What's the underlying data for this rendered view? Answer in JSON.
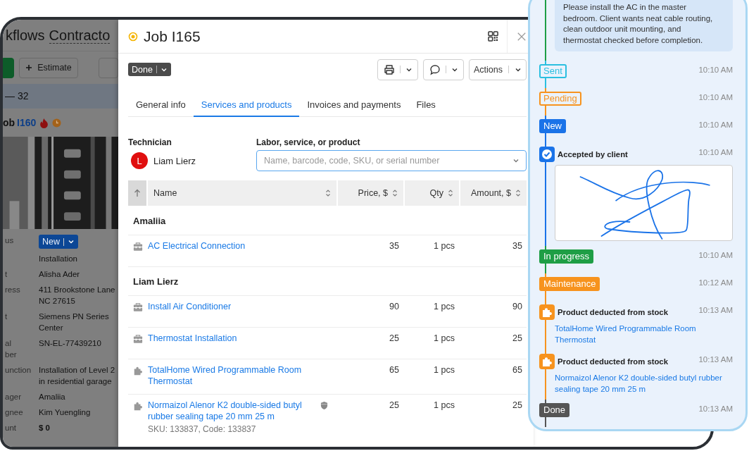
{
  "background_app": {
    "title": "kflows",
    "selector": "Contracto",
    "buttons": [
      {
        "kind": "primary"
      },
      {
        "kind": "secondary",
        "label": "Estimate"
      },
      {
        "kind": "filter"
      }
    ],
    "list_header": "— 32",
    "card": {
      "title_prefix": "ob",
      "number": "I160",
      "flags": [
        {
          "kind": "fire"
        },
        {
          "kind": "clock"
        }
      ],
      "fields": [
        {
          "kind": "badge",
          "label": "us",
          "value": "New"
        },
        {
          "kind": "text",
          "value": "Installation"
        },
        {
          "kind": "text",
          "label": "t",
          "value": "Alisha Ader"
        },
        {
          "kind": "text",
          "label": "ress",
          "value": "411 Brookstone Lane\nNC 27615"
        },
        {
          "kind": "text",
          "label": "t",
          "value": "Siemens PN Series\nCenter"
        },
        {
          "kind": "text",
          "label": "al\nber",
          "value": "SN-EL-77439210"
        },
        {
          "kind": "text",
          "label": "unction",
          "value": "Installation of Level 2\nin residential garage"
        },
        {
          "kind": "text",
          "label": "ager",
          "value": "Amaliia"
        },
        {
          "kind": "text",
          "label": "gnee",
          "value": "Kim Yuengling"
        },
        {
          "kind": "total",
          "label": "unt",
          "value": "$ 0"
        }
      ]
    }
  },
  "modal": {
    "title": "Job I165",
    "status": "Done",
    "toolbar": [
      {
        "kind": "print"
      },
      {
        "kind": "chat"
      },
      {
        "kind": "text",
        "label": "Actions"
      }
    ],
    "tabs": [
      {
        "label": "General info",
        "selected": false
      },
      {
        "label": "Services and products",
        "selected": true
      },
      {
        "label": "Invoices and payments",
        "selected": false
      },
      {
        "label": "Files",
        "selected": false
      }
    ],
    "technician": {
      "label": "Technician",
      "initial": "L",
      "name": "Liam Lierz"
    },
    "product_field": {
      "label": "Labor, service, or product",
      "placeholder": "Name, barcode, code, SKU, or serial number"
    },
    "table": {
      "columns": [
        "Name",
        "Price, $",
        "Qty",
        "Amount, $"
      ],
      "groups": [
        {
          "name": "Amaliia",
          "rows": [
            {
              "kind": "service",
              "name": "AC Electrical Connection",
              "price": "35",
              "qty": "1 pcs",
              "amount": "35",
              "shield": false
            }
          ]
        },
        {
          "name": "Liam Lierz",
          "rows": [
            {
              "kind": "service",
              "name": "Install Air Conditioner",
              "price": "90",
              "qty": "1 pcs",
              "amount": "90",
              "shield": false
            },
            {
              "kind": "service",
              "name": "Thermostat Installation",
              "price": "25",
              "qty": "1 pcs",
              "amount": "25",
              "shield": false
            },
            {
              "kind": "product",
              "name": "TotalHome Wired Programmable Room Thermostat",
              "price": "65",
              "qty": "1 pcs",
              "amount": "65",
              "shield": false
            },
            {
              "kind": "product",
              "name": "Normaizol Alenor K2 double-sided butyl rubber sealing tape 20 mm 25 m",
              "details": "SKU: 133837, Code: 133837",
              "price": "25",
              "qty": "1 pcs",
              "amount": "25",
              "shield": true
            }
          ]
        }
      ]
    }
  },
  "timeline": {
    "items": [
      {
        "kind": "note",
        "color": "#1e9e45",
        "text": "Please install the AC in the master bedroom. Client wants neat cable routing, clean outdoor unit mounting, and thermostat checked before completion."
      },
      {
        "kind": "status",
        "label": "Sent",
        "outline": true,
        "color": "#2bbfe0",
        "time": "10:10 AM"
      },
      {
        "kind": "status",
        "label": "Pending",
        "outline": true,
        "color": "#f7931e",
        "time": "10:10 AM"
      },
      {
        "kind": "status",
        "label": "New",
        "outline": false,
        "color": "#1a73e8",
        "time": "10:10 AM"
      },
      {
        "kind": "approval",
        "title": "Accepted by client",
        "color": "#1a73e8",
        "time": "10:10 AM",
        "signature": true
      },
      {
        "kind": "status",
        "label": "In progress",
        "outline": false,
        "color": "#1e9e45",
        "time": "10:10 AM"
      },
      {
        "kind": "status",
        "label": "Maintenance",
        "outline": false,
        "color": "#f7931e",
        "time": "10:12 AM"
      },
      {
        "kind": "stock",
        "title": "Product deducted from stock",
        "color": "#f7931e",
        "time": "10:13 AM",
        "link": "TotalHome Wired Programmable Room Thermostat"
      },
      {
        "kind": "stock",
        "title": "Product deducted from stock",
        "color": "#f7931e",
        "time": "10:13 AM",
        "link": "Normaizol Alenor K2 double-sided butyl rubber sealing tape 20 mm 25 m"
      },
      {
        "kind": "status",
        "label": "Done",
        "outline": false,
        "color": "#555555",
        "time": "10:13 AM"
      }
    ]
  }
}
